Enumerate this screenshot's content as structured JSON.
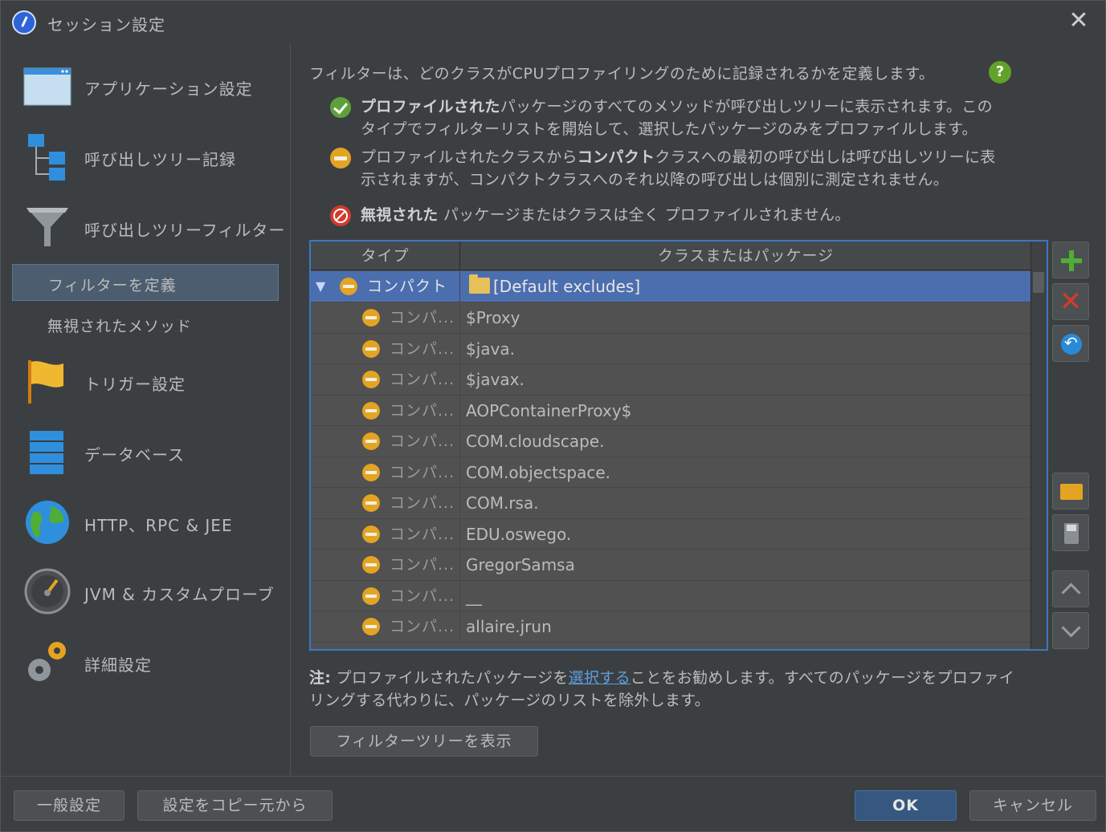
{
  "window": {
    "title": "セッション設定",
    "close_glyph": "✕"
  },
  "sidebar": {
    "items": [
      {
        "label": "アプリケーション設定",
        "icon": "window-icon"
      },
      {
        "label": "呼び出しツリー記録",
        "icon": "tree-icon"
      },
      {
        "label": "呼び出しツリーフィルター",
        "icon": "funnel-icon"
      },
      {
        "label": "トリガー設定",
        "icon": "flag-icon"
      },
      {
        "label": "データベース",
        "icon": "database-icon"
      },
      {
        "label": "HTTP、RPC & JEE",
        "icon": "globe-icon"
      },
      {
        "label": "JVM & カスタムプローブ",
        "icon": "gauge-icon"
      },
      {
        "label": "詳細設定",
        "icon": "gears-icon"
      }
    ],
    "sub_items": [
      {
        "label": "フィルターを定義",
        "selected": true
      },
      {
        "label": "無視されたメソッド",
        "selected": false
      }
    ]
  },
  "main": {
    "intro": "フィルターは、どのクラスがCPUプロファイリングのために記録されるかを定義します。",
    "legend": {
      "profiled_bold": "プロファイルされた",
      "profiled_line1": "パッケージのすべてのメソッドが呼び出しツリーに表示されます。この",
      "profiled_line2": "タイプでフィルターリストを開始して、選択したパッケージのみをプロファイルします。",
      "compact_pre": "プロファイルされたクラスから",
      "compact_bold": "コンパクト",
      "compact_line1": "クラスへの最初の呼び出しは呼び出しツリーに表",
      "compact_line2": "示されますが、コンパクトクラスへのそれ以降の呼び出しは個別に測定されません。",
      "ignored_bold": "無視された",
      "ignored_text": " パッケージまたはクラスは全く プロファイルされません。"
    },
    "table": {
      "headers": [
        "タイプ",
        "クラスまたはパッケージ"
      ],
      "group": {
        "expander": "▼",
        "type": "コンパクト",
        "value": "[Default excludes]"
      },
      "rows": [
        {
          "type": "コンパ...",
          "value": "$Proxy"
        },
        {
          "type": "コンパ...",
          "value": "$java."
        },
        {
          "type": "コンパ...",
          "value": "$javax."
        },
        {
          "type": "コンパ...",
          "value": "AOPContainerProxy$"
        },
        {
          "type": "コンパ...",
          "value": "COM.cloudscape."
        },
        {
          "type": "コンパ...",
          "value": "COM.objectspace."
        },
        {
          "type": "コンパ...",
          "value": "COM.rsa."
        },
        {
          "type": "コンパ...",
          "value": "EDU.oswego."
        },
        {
          "type": "コンパ...",
          "value": "GregorSamsa"
        },
        {
          "type": "コンパ...",
          "value": "__"
        },
        {
          "type": "コンパ...",
          "value": "allaire.jrun"
        }
      ]
    },
    "note": {
      "bold": "注:",
      "pre": " プロファイルされたパッケージを",
      "link": "選択する",
      "post": "ことをお勧めします。すべてのパッケージをプロファイ",
      "line2": "リングする代わりに、パッケージのリストを除外します。"
    },
    "show_tree_button": "フィルターツリーを表示",
    "help_glyph": "?"
  },
  "footer": {
    "general_settings": "一般設定",
    "copy_settings": "設定をコピー元から",
    "ok": "OK",
    "cancel": "キャンセル"
  },
  "colors": {
    "selection": "#4b6eaf",
    "accent_border": "#3a78c2",
    "compact": "#e3a323",
    "profiled": "#5ea13a",
    "ignored": "#d33b2c"
  }
}
